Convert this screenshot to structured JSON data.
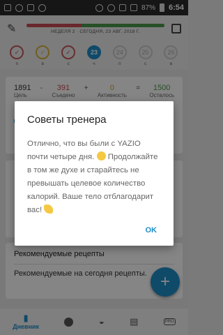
{
  "status": {
    "battery": "87%",
    "time": "6:54"
  },
  "header": {
    "week": "НЕДЕЛЯ 2",
    "separator": "·",
    "today": "СЕГОДНЯ, 23 АВГ. 2018 Г."
  },
  "days": [
    {
      "num": "",
      "label": "п",
      "state": "red"
    },
    {
      "num": "",
      "label": "в",
      "state": "yellow"
    },
    {
      "num": "",
      "label": "с",
      "state": "red"
    },
    {
      "num": "23",
      "label": "ч",
      "state": "today"
    },
    {
      "num": "24",
      "label": "п",
      "state": "future"
    },
    {
      "num": "25",
      "label": "с",
      "state": "future"
    },
    {
      "num": "26",
      "label": "в",
      "state": "future"
    }
  ],
  "stats": {
    "goal_value": "1891",
    "goal_label": "Цель",
    "minus": "-",
    "eaten_value": "391",
    "eaten_label": "Съедено",
    "plus": "+",
    "activity_value": "0",
    "activity_label": "Активность",
    "equals": "=",
    "left_value": "1500",
    "left_label": "Осталось"
  },
  "recipes": {
    "title": "Рекомендуемые рецепты",
    "text": "Рекомендуемые на сегодня рецепты."
  },
  "fab": {
    "label": "+"
  },
  "nav": {
    "diary_label": "Дневник"
  },
  "dialog": {
    "title": "Советы тренера",
    "body": "Отлично, что вы были с YAZIO почти четыре дня.",
    "body2": "Продолжайте в том же духе и старайтесь не превышать целевое количество калорий. Ваше тело отблагодарит вас!",
    "ok": "OK"
  }
}
